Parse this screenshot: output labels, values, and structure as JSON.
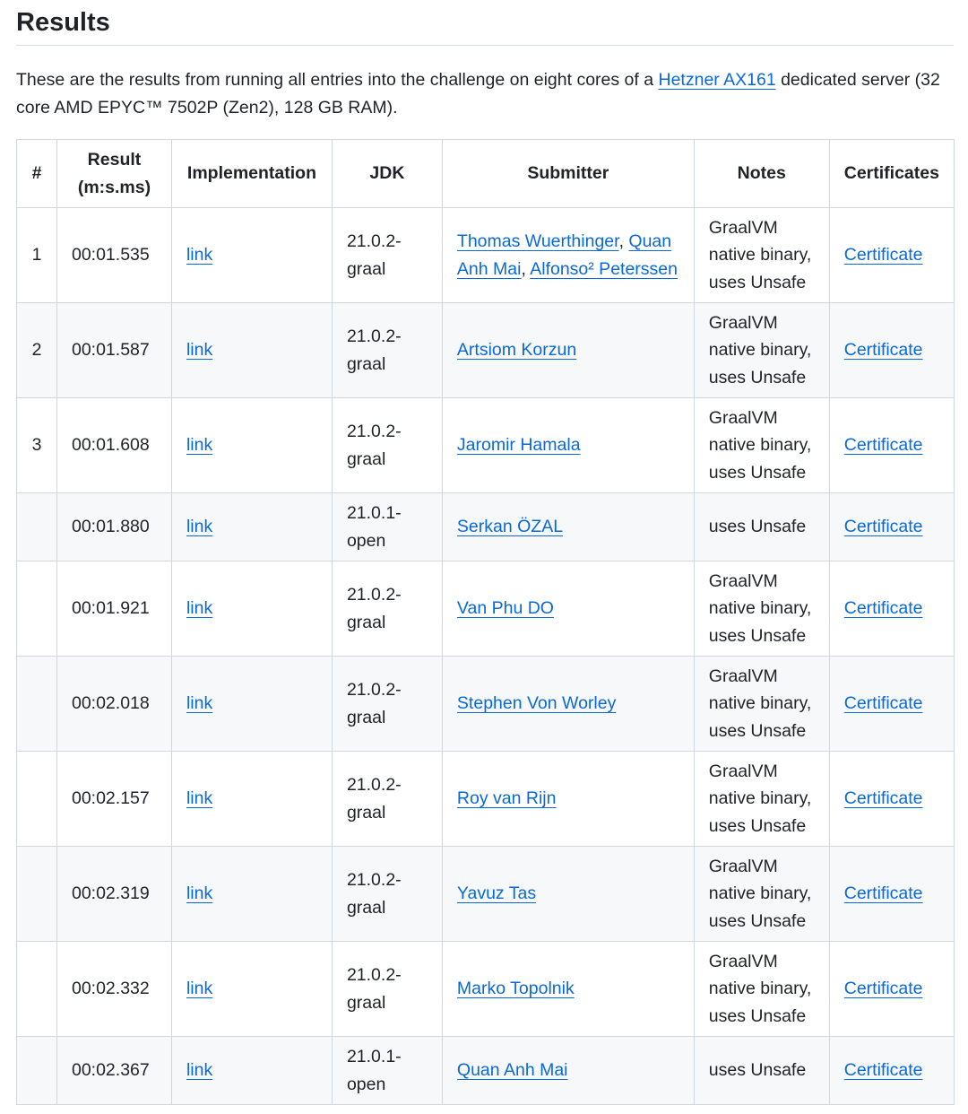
{
  "heading": "Results",
  "intro": {
    "before": "These are the results from running all entries into the challenge on eight cores of a ",
    "link": "Hetzner AX161",
    "after": " dedicated server (32 core AMD EPYC™ 7502P (Zen2), 128 GB RAM)."
  },
  "table": {
    "headers": {
      "rank": "#",
      "result": "Result (m:s.ms)",
      "implementation": "Implementation",
      "jdk": "JDK",
      "submitter": "Submitter",
      "notes": "Notes",
      "certificates": "Certificates"
    },
    "rows": [
      {
        "rank": "1",
        "result": "00:01.535",
        "impl": "link",
        "jdk": "21.0.2-graal",
        "submitters": [
          "Thomas Wuerthinger",
          "Quan Anh Mai",
          "Alfonso² Peterssen"
        ],
        "notes": "GraalVM native binary, uses Unsafe",
        "cert": "Certificate"
      },
      {
        "rank": "2",
        "result": "00:01.587",
        "impl": "link",
        "jdk": "21.0.2-graal",
        "submitters": [
          "Artsiom Korzun"
        ],
        "notes": "GraalVM native binary, uses Unsafe",
        "cert": "Certificate"
      },
      {
        "rank": "3",
        "result": "00:01.608",
        "impl": "link",
        "jdk": "21.0.2-graal",
        "submitters": [
          "Jaromir Hamala"
        ],
        "notes": "GraalVM native binary, uses Unsafe",
        "cert": "Certificate"
      },
      {
        "rank": "",
        "result": "00:01.880",
        "impl": "link",
        "jdk": "21.0.1-open",
        "submitters": [
          "Serkan ÖZAL"
        ],
        "notes": "uses Unsafe",
        "cert": "Certificate"
      },
      {
        "rank": "",
        "result": "00:01.921",
        "impl": "link",
        "jdk": "21.0.2-graal",
        "submitters": [
          "Van Phu DO"
        ],
        "notes": "GraalVM native binary, uses Unsafe",
        "cert": "Certificate"
      },
      {
        "rank": "",
        "result": "00:02.018",
        "impl": "link",
        "jdk": "21.0.2-graal",
        "submitters": [
          "Stephen Von Worley"
        ],
        "notes": "GraalVM native binary, uses Unsafe",
        "cert": "Certificate"
      },
      {
        "rank": "",
        "result": "00:02.157",
        "impl": "link",
        "jdk": "21.0.2-graal",
        "submitters": [
          "Roy van Rijn"
        ],
        "notes": "GraalVM native binary, uses Unsafe",
        "cert": "Certificate"
      },
      {
        "rank": "",
        "result": "00:02.319",
        "impl": "link",
        "jdk": "21.0.2-graal",
        "submitters": [
          "Yavuz Tas"
        ],
        "notes": "GraalVM native binary, uses Unsafe",
        "cert": "Certificate"
      },
      {
        "rank": "",
        "result": "00:02.332",
        "impl": "link",
        "jdk": "21.0.2-graal",
        "submitters": [
          "Marko Topolnik"
        ],
        "notes": "GraalVM native binary, uses Unsafe",
        "cert": "Certificate"
      },
      {
        "rank": "",
        "result": "00:02.367",
        "impl": "link",
        "jdk": "21.0.1-open",
        "submitters": [
          "Quan Anh Mai"
        ],
        "notes": "uses Unsafe",
        "cert": "Certificate"
      }
    ]
  }
}
